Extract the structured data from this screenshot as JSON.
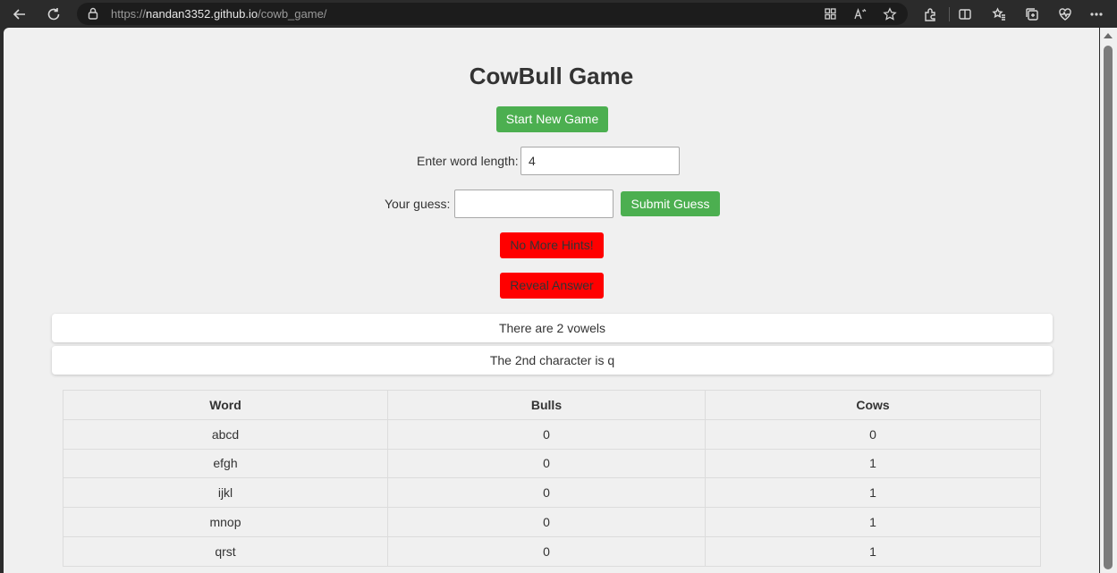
{
  "browser": {
    "url_prefix": "https://",
    "url_host": "nandan3352.github.io",
    "url_path": "/cowb_game/"
  },
  "page": {
    "title": "CowBull Game",
    "start_button": "Start New Game",
    "word_length_label": "Enter word length:",
    "word_length_value": "4",
    "guess_label": "Your guess:",
    "guess_value": "",
    "submit_button": "Submit Guess",
    "hint_button": "No More Hints!",
    "reveal_button": "Reveal Answer",
    "hints": [
      "There are 2 vowels",
      "The 2nd character is q"
    ],
    "table": {
      "headers": [
        "Word",
        "Bulls",
        "Cows"
      ],
      "rows": [
        [
          "abcd",
          "0",
          "0"
        ],
        [
          "efgh",
          "0",
          "1"
        ],
        [
          "ijkl",
          "0",
          "1"
        ],
        [
          "mnop",
          "0",
          "1"
        ],
        [
          "qrst",
          "0",
          "1"
        ]
      ]
    }
  },
  "colors": {
    "green_button": "#4caf50",
    "red_button": "#ff0000",
    "page_background": "#f0f0f0"
  },
  "icons": {
    "toolbar_left": [
      "back-icon",
      "refresh-icon"
    ],
    "address": [
      "lock-info-icon",
      "app-grid-icon",
      "read-aloud-icon",
      "favorite-star-icon"
    ],
    "toolbar_right": [
      "extensions-icon",
      "split-screen-icon",
      "favorites-icon",
      "collections-icon",
      "browser-essentials-icon",
      "more-icon"
    ]
  }
}
